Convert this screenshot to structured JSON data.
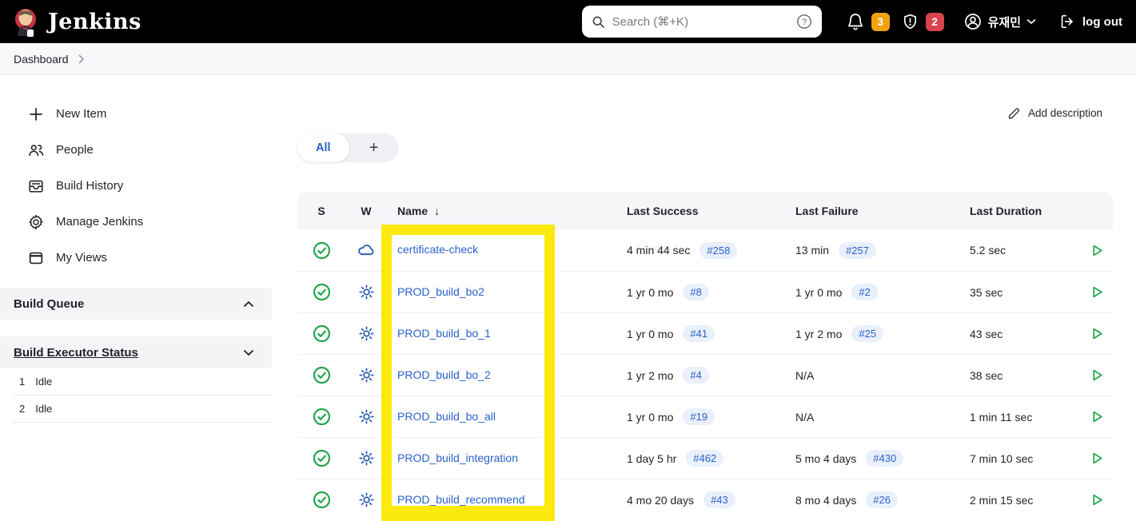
{
  "topbar": {
    "brand": "Jenkins",
    "search": {
      "placeholder": "Search (⌘+K)"
    },
    "notifications": {
      "bell_count": "3",
      "security_count": "2"
    },
    "user": {
      "name": "유재민"
    },
    "logout_label": "log out"
  },
  "breadcrumb": {
    "root": "Dashboard"
  },
  "sidebar": {
    "items": [
      {
        "label": "New Item",
        "icon": "plus-icon"
      },
      {
        "label": "People",
        "icon": "people-icon"
      },
      {
        "label": "Build History",
        "icon": "build-history-icon"
      },
      {
        "label": "Manage Jenkins",
        "icon": "gear-icon"
      },
      {
        "label": "My Views",
        "icon": "window-icon"
      }
    ],
    "build_queue": {
      "title": "Build Queue",
      "state": "collapsed"
    },
    "executor_status": {
      "title": "Build Executor Status",
      "state": "expanded",
      "executors": [
        {
          "number": "1",
          "state": "Idle"
        },
        {
          "number": "2",
          "state": "Idle"
        }
      ]
    }
  },
  "main": {
    "tabs": {
      "active_label": "All",
      "new_view_label": "+"
    },
    "add_description_label": "Add description",
    "table": {
      "headers": {
        "status": "S",
        "weather": "W",
        "name": "Name",
        "sort_arrow": "↓",
        "last_success": "Last Success",
        "last_failure": "Last Failure",
        "last_duration": "Last Duration"
      },
      "rows": [
        {
          "status": "success",
          "weather": "cloudy",
          "name": "certificate-check",
          "success_time": "4 min 44 sec",
          "success_badge": "#258",
          "failure_time": "13 min",
          "failure_badge": "#257",
          "duration": "5.2 sec"
        },
        {
          "status": "success",
          "weather": "sunny",
          "name": "PROD_build_bo2",
          "success_time": "1 yr 0 mo",
          "success_badge": "#8",
          "failure_time": "1 yr 0 mo",
          "failure_badge": "#2",
          "duration": "35 sec"
        },
        {
          "status": "success",
          "weather": "sunny",
          "name": "PROD_build_bo_1",
          "success_time": "1 yr 0 mo",
          "success_badge": "#41",
          "failure_time": "1 yr 2 mo",
          "failure_badge": "#25",
          "duration": "43 sec"
        },
        {
          "status": "success",
          "weather": "sunny",
          "name": "PROD_build_bo_2",
          "success_time": "1 yr 2 mo",
          "success_badge": "#4",
          "failure_time": "N/A",
          "failure_badge": "",
          "duration": "38 sec"
        },
        {
          "status": "success",
          "weather": "sunny",
          "name": "PROD_build_bo_all",
          "success_time": "1 yr 0 mo",
          "success_badge": "#19",
          "failure_time": "N/A",
          "failure_badge": "",
          "duration": "1 min 11 sec"
        },
        {
          "status": "success",
          "weather": "sunny",
          "name": "PROD_build_integration",
          "success_time": "1 day 5 hr",
          "success_badge": "#462",
          "failure_time": "5 mo 4 days",
          "failure_badge": "#430",
          "duration": "7 min 10 sec"
        },
        {
          "status": "success",
          "weather": "sunny",
          "name": "PROD_build_recommend",
          "success_time": "4 mo 20 days",
          "success_badge": "#43",
          "failure_time": "8 mo 4 days",
          "failure_badge": "#26",
          "duration": "2 min 15 sec"
        }
      ]
    }
  },
  "colors": {
    "topbar_bg": "#000000",
    "link_blue": "#2962cc",
    "badge_bg": "#e9effb",
    "success_green": "#1ea64b",
    "weather_blue": "#2457b5",
    "notification_orange": "#f2a20d",
    "security_red": "#d9434e",
    "highlight_yellow": "#fbea0b"
  },
  "icons": {
    "search": "magnifier",
    "help": "question-circle",
    "bell": "notification-bell",
    "shield": "security-shield",
    "user": "person-circle",
    "logout": "door-arrow",
    "pencil": "edit-pencil",
    "status": "check-circle",
    "weather_sunny": "sun",
    "weather_cloudy": "cloud",
    "run": "play-triangle"
  }
}
